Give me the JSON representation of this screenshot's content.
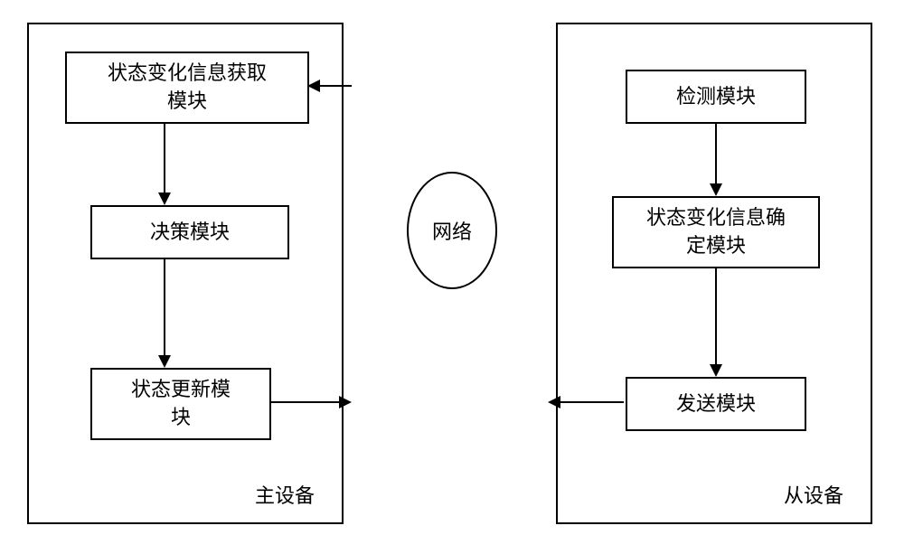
{
  "left_device": {
    "label": "主设备",
    "modules": {
      "acquisition": "状态变化信息获取\n模块",
      "decision": "决策模块",
      "update": "状态更新模\n块"
    }
  },
  "right_device": {
    "label": "从设备",
    "modules": {
      "detection": "检测模块",
      "determine": "状态变化信息确\n定模块",
      "send": "发送模块"
    }
  },
  "network": "网络"
}
